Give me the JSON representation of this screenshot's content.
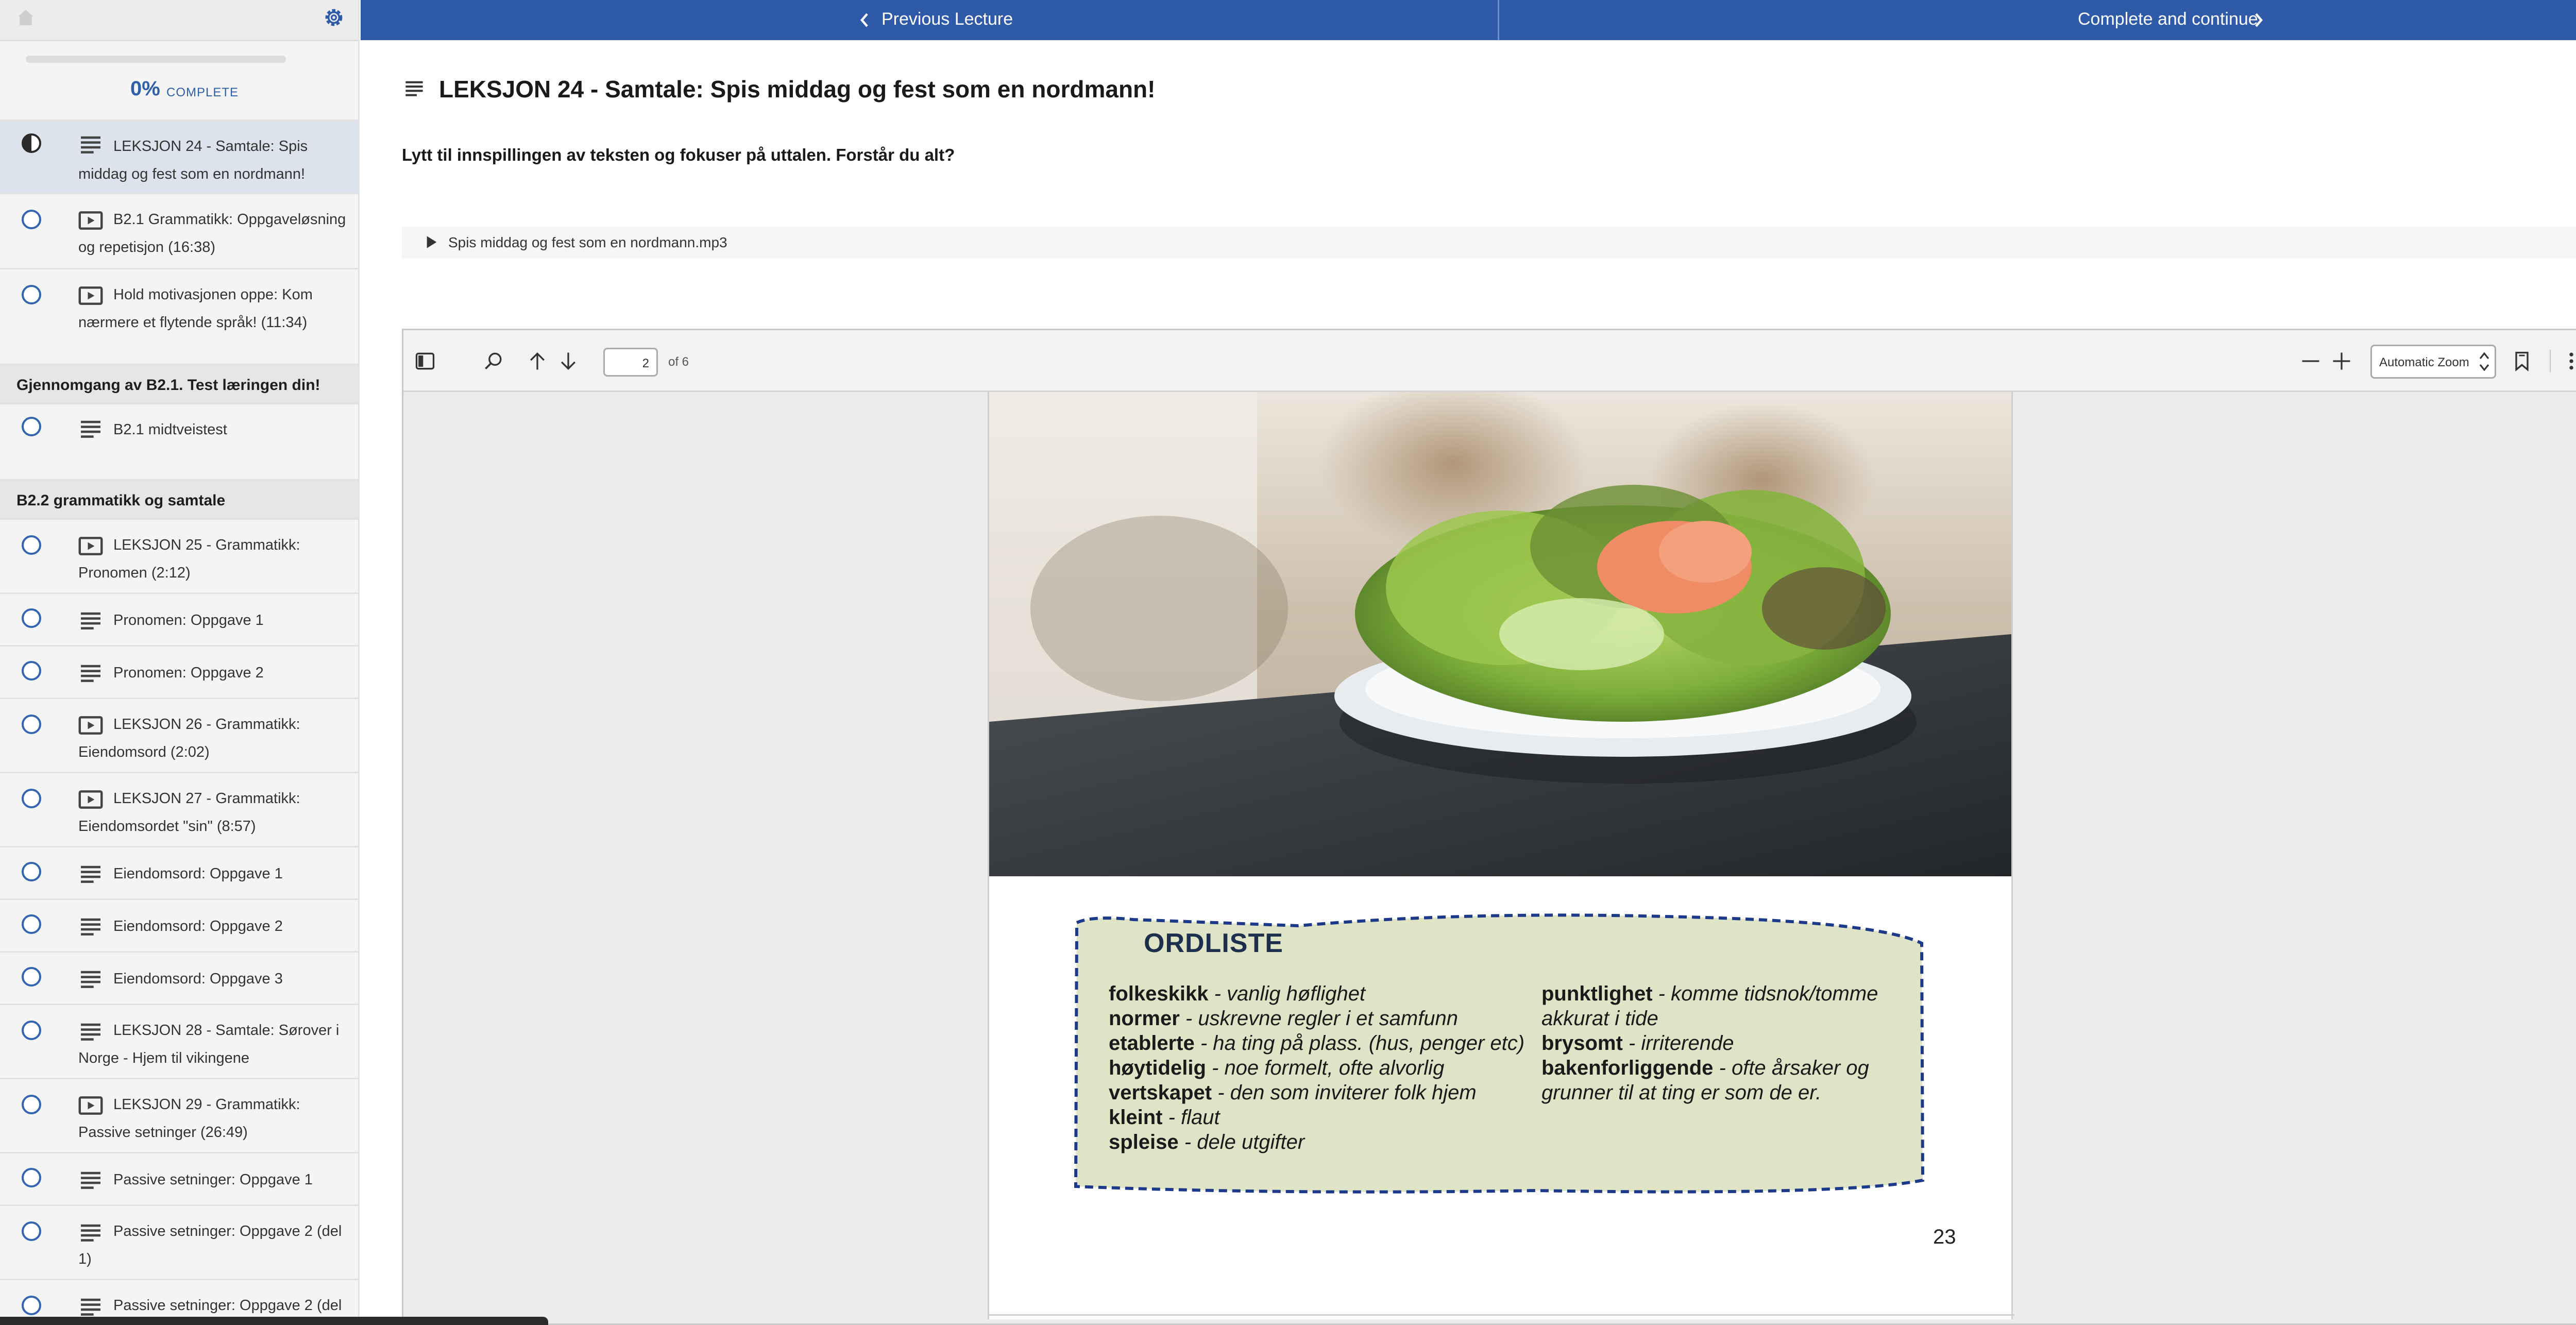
{
  "colors": {
    "primary": "#2e5aa8",
    "sidebar_bg": "#f4f4f4",
    "active_row": "#dde3ec",
    "ordliste_fill": "#dfe4c7",
    "ordliste_border": "#1d3a8a"
  },
  "sidebar": {
    "progress_percent": "0%",
    "progress_label": "COMPLETE",
    "items": [
      {
        "label": "LEKSJON 24 - Samtale: Spis middag og fest som en nordmann!",
        "icon": "text-lines-icon",
        "state": "in-progress"
      },
      {
        "label": "B2.1 Grammatikk: Oppgaveløsning og repetisjon (16:38)",
        "icon": "video-icon",
        "state": "not-started"
      },
      {
        "label": "Hold motivasjonen oppe: Kom nærmere et flytende språk! (11:34)",
        "icon": "video-icon",
        "state": "not-started"
      }
    ],
    "section1": "Gjennomgang av B2.1. Test læringen din!",
    "section1_items": [
      {
        "label": "B2.1 midtveistest",
        "icon": "text-lines-icon"
      }
    ],
    "section2": "B2.2 grammatikk og samtale",
    "section2_items": [
      {
        "label": "LEKSJON 25 - Grammatikk: Pronomen (2:12)",
        "icon": "video-icon"
      },
      {
        "label": "Pronomen: Oppgave 1",
        "icon": "text-lines-icon"
      },
      {
        "label": "Pronomen: Oppgave 2",
        "icon": "text-lines-icon"
      },
      {
        "label": "LEKSJON 26 - Grammatikk: Eiendomsord (2:02)",
        "icon": "video-icon"
      },
      {
        "label": "LEKSJON 27 - Grammatikk: Eiendomsordet \"sin\" (8:57)",
        "icon": "video-icon"
      },
      {
        "label": "Eiendomsord: Oppgave 1",
        "icon": "text-lines-icon"
      },
      {
        "label": "Eiendomsord: Oppgave 2",
        "icon": "text-lines-icon"
      },
      {
        "label": "Eiendomsord: Oppgave 3",
        "icon": "text-lines-icon"
      },
      {
        "label": "LEKSJON 28 - Samtale: Sørover i Norge - Hjem til vikingene",
        "icon": "text-lines-icon"
      },
      {
        "label": "LEKSJON 29 - Grammatikk: Passive setninger (26:49)",
        "icon": "video-icon"
      },
      {
        "label": "Passive setninger: Oppgave 1",
        "icon": "text-lines-icon"
      },
      {
        "label": "Passive setninger: Oppgave 2 (del 1)",
        "icon": "text-lines-icon"
      },
      {
        "label": "Passive setninger: Oppgave 2 (del",
        "icon": "text-lines-icon"
      }
    ]
  },
  "topbar": {
    "prev_label": "Previous Lecture",
    "next_label": "Complete and continue"
  },
  "lecture": {
    "title": "LEKSJON 24 - Samtale: Spis middag og fest som en nordmann!",
    "instruction": "Lytt til innspillingen av teksten og fokuser på uttalen. Forstår du alt?",
    "audio_file": "Spis middag og fest som en nordmann.mp3"
  },
  "pdf": {
    "page_current": "2",
    "page_total_label": "of 6",
    "zoom": "Automatic Zoom",
    "ordliste_title": "ORDLISTE",
    "left_terms": [
      {
        "term": "folkeskikk",
        "def": " - vanlig høflighet"
      },
      {
        "term": "normer",
        "def": " - uskrevne regler i et samfunn"
      },
      {
        "term": "etablerte",
        "def": " - ha ting på plass. (hus, penger etc)"
      },
      {
        "term": "høytidelig",
        "def": " - noe formelt, ofte alvorlig"
      },
      {
        "term": "vertskapet",
        "def": " - den som inviterer folk hjem"
      },
      {
        "term": "kleint",
        "def": " - flaut"
      },
      {
        "term": "spleise",
        "def": " - dele utgifter"
      }
    ],
    "right_terms": [
      {
        "term": "punktlighet",
        "def": " - komme tidsnok/tomme akkurat i tide"
      },
      {
        "term": "brysomt",
        "def": " - irriterende"
      },
      {
        "term": "bakenforliggende",
        "def": " - ofte årsaker og grunner til at ting er som de er."
      }
    ],
    "page_number": "23"
  }
}
